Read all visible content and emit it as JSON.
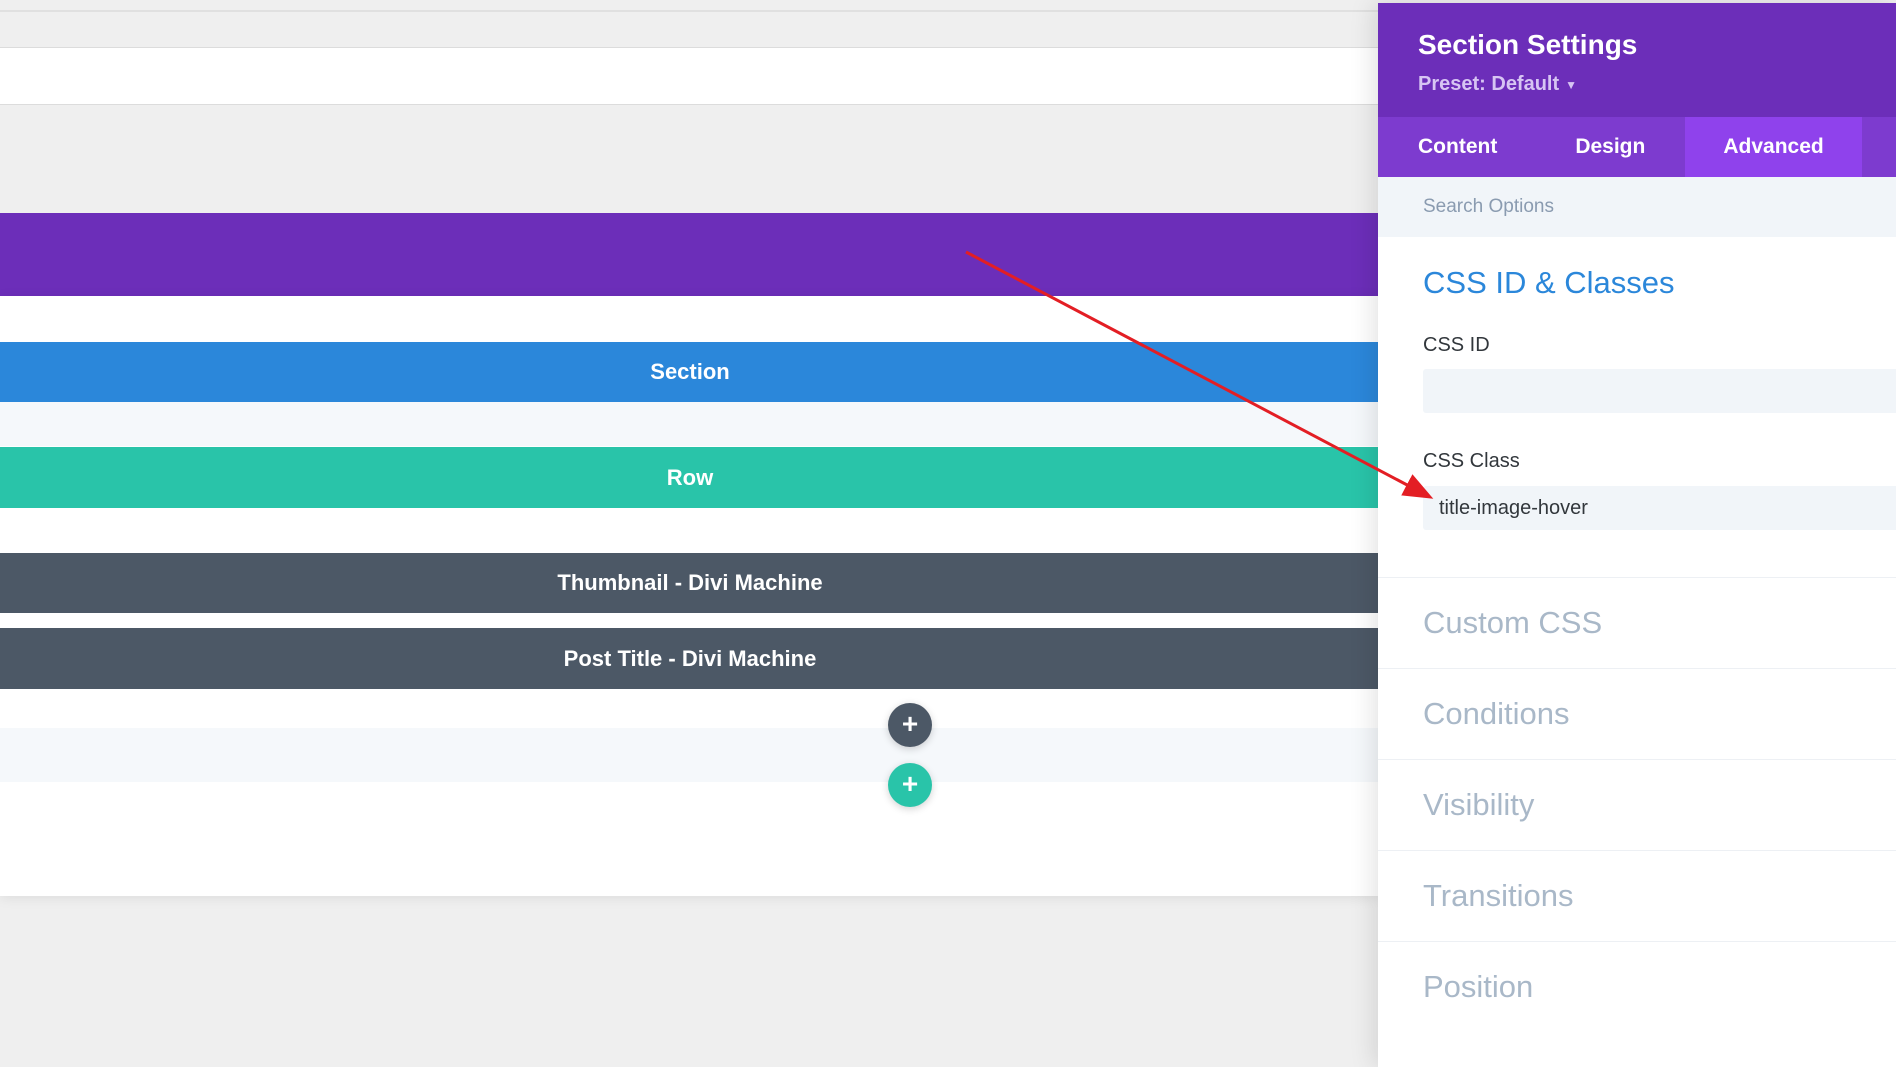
{
  "builder": {
    "section_label": "Section",
    "row_label": "Row",
    "modules": [
      "Thumbnail - Divi Machine",
      "Post Title - Divi Machine"
    ],
    "add_symbol": "+"
  },
  "panel": {
    "title": "Section Settings",
    "preset": "Preset: Default",
    "tabs": [
      "Content",
      "Design",
      "Advanced"
    ],
    "active_tab": "Advanced",
    "search_placeholder": "Search Options",
    "open_group": "CSS ID & Classes",
    "css_id_label": "CSS ID",
    "css_id_value": "",
    "css_class_label": "CSS Class",
    "css_class_value": "title-image-hover",
    "groups": [
      "Custom CSS",
      "Conditions",
      "Visibility",
      "Transitions",
      "Position"
    ]
  },
  "colors": {
    "purple": "#6c2eb9",
    "section_blue": "#2b87da",
    "row_teal": "#29c4a9",
    "module_gray": "#4c5866",
    "arrow_red": "#e31e24"
  }
}
